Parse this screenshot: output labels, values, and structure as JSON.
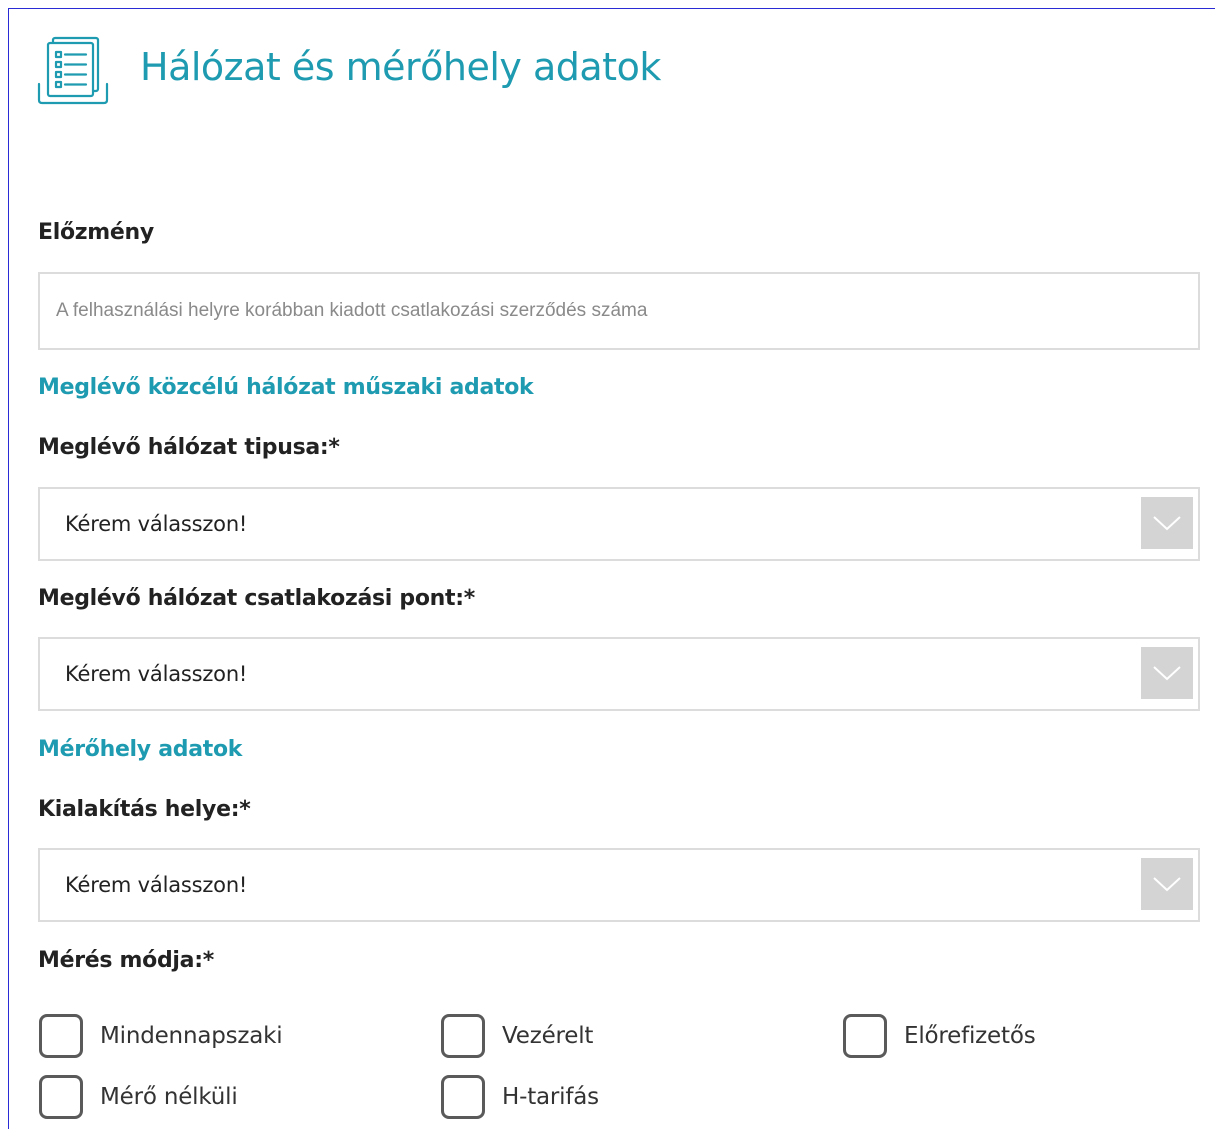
{
  "header": {
    "title": "Hálózat és mérőhely adatok",
    "icon": "document-list-icon",
    "accent_color": "#1e9bb0"
  },
  "elozmeny": {
    "label": "Előzmény",
    "placeholder": "A felhasználási helyre korábban kiadott csatlakozási szerződés száma",
    "value": ""
  },
  "network_section": {
    "title": "Meglévő közcélú hálózat műszaki adatok",
    "network_type": {
      "label": "Meglévő hálózat tipusa:*",
      "selected": "Kérem válasszon!"
    },
    "connection_point": {
      "label": "Meglévő hálózat csatlakozási pont:*",
      "selected": "Kérem válasszon!"
    }
  },
  "meter_section": {
    "title": "Mérőhely adatok",
    "location": {
      "label": "Kialakítás helye:*",
      "selected": "Kérem válasszon!"
    },
    "measurement": {
      "label": "Mérés módja:*",
      "options": [
        {
          "label": "Mindennapszaki",
          "checked": false
        },
        {
          "label": "Vezérelt",
          "checked": false
        },
        {
          "label": "Előrefizetős",
          "checked": false
        },
        {
          "label": "Mérő nélküli",
          "checked": false
        },
        {
          "label": "H-tarifás",
          "checked": false
        }
      ]
    }
  }
}
